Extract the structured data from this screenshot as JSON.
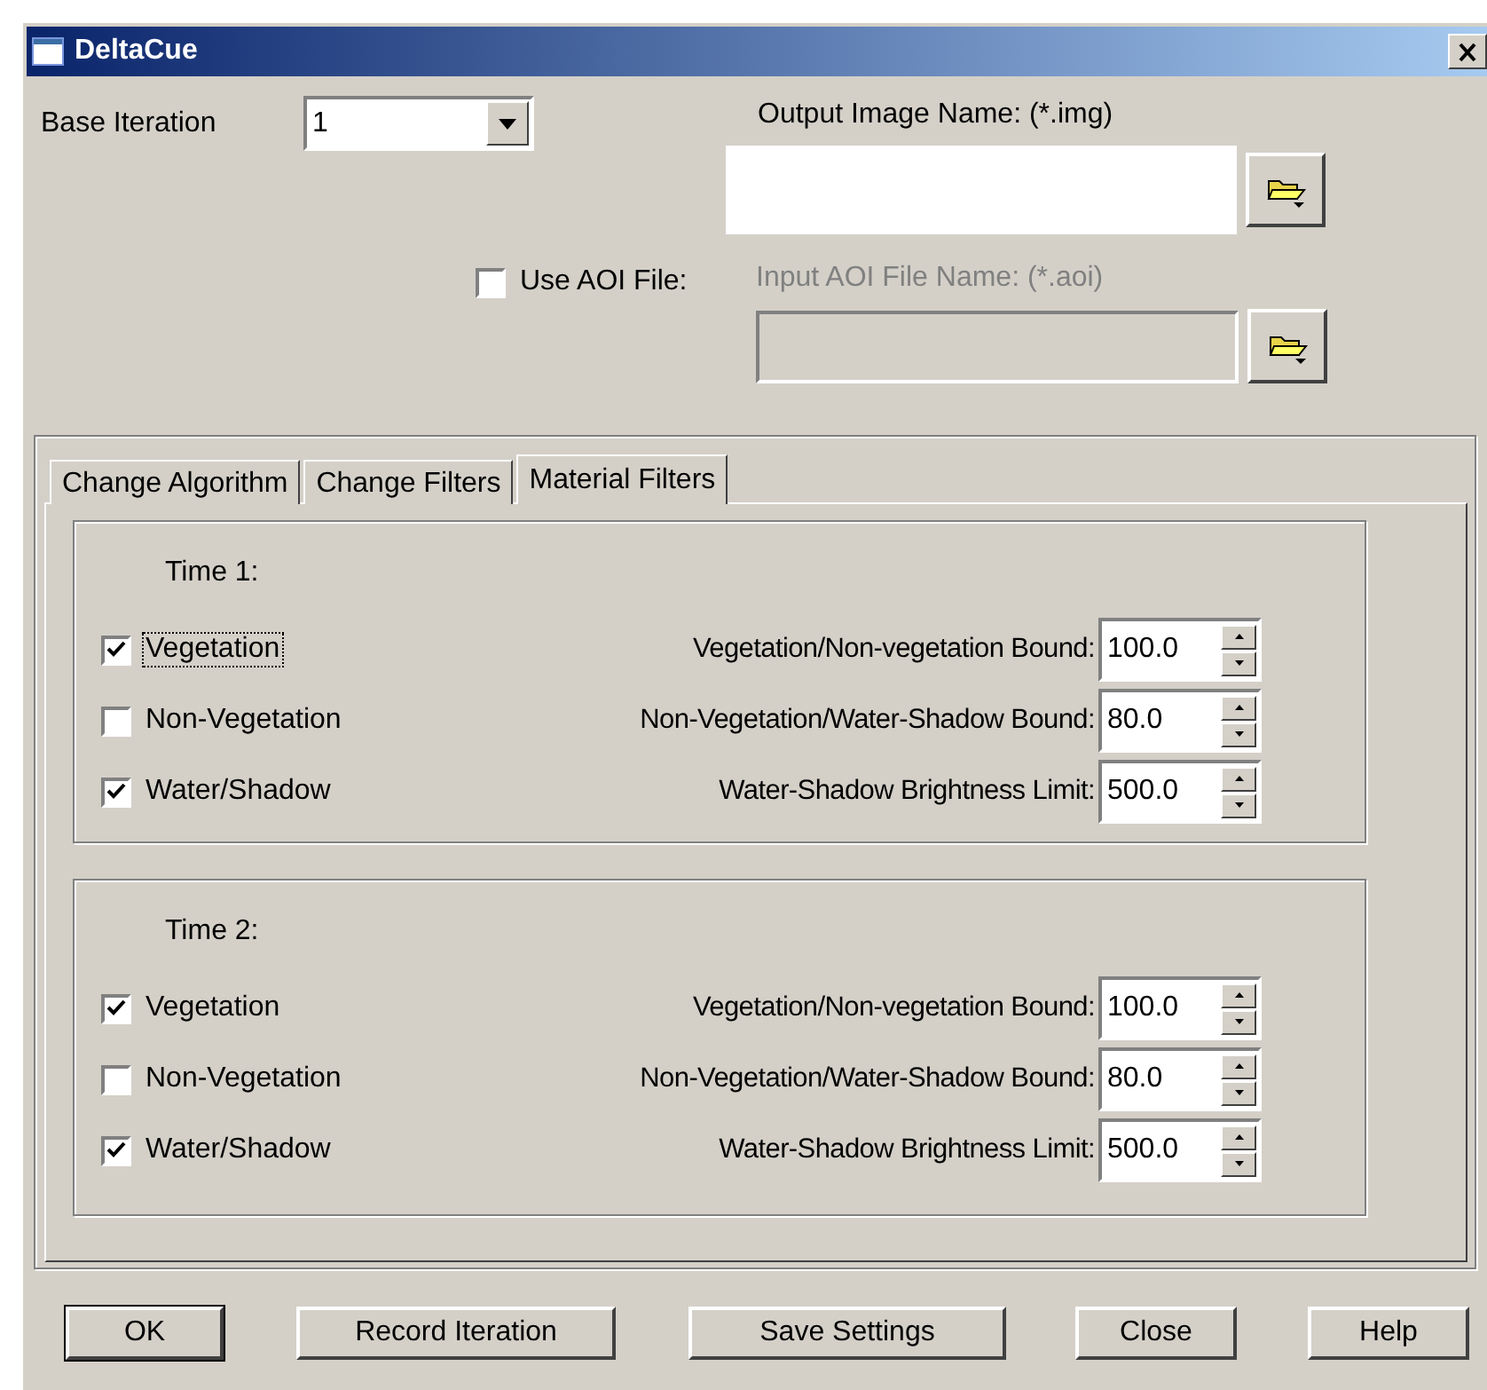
{
  "window": {
    "title": "DeltaCue"
  },
  "base_iteration": {
    "label": "Base Iteration",
    "value": "1"
  },
  "output_image": {
    "label": "Output Image Name: (*.img)"
  },
  "use_aoi": {
    "label": "Use AOI File:",
    "checked": false
  },
  "input_aoi": {
    "label": "Input AOI File Name: (*.aoi)",
    "disabled": true
  },
  "tabs": [
    {
      "label": "Change Algorithm",
      "selected": false
    },
    {
      "label": "Change Filters",
      "selected": false
    },
    {
      "label": "Material Filters",
      "selected": true
    }
  ],
  "groups": [
    {
      "title": "Time 1:",
      "filters": [
        {
          "label": "Vegetation",
          "checked": true,
          "focused": true
        },
        {
          "label": "Non-Vegetation",
          "checked": false,
          "focused": false
        },
        {
          "label": "Water/Shadow",
          "checked": true,
          "focused": false
        }
      ],
      "bounds": [
        {
          "label": "Vegetation/Non-vegetation Bound:",
          "value": "100.0"
        },
        {
          "label": "Non-Vegetation/Water-Shadow Bound:",
          "value": "80.0"
        },
        {
          "label": "Water-Shadow Brightness Limit:",
          "value": "500.0"
        }
      ]
    },
    {
      "title": "Time 2:",
      "filters": [
        {
          "label": "Vegetation",
          "checked": true,
          "focused": false
        },
        {
          "label": "Non-Vegetation",
          "checked": false,
          "focused": false
        },
        {
          "label": "Water/Shadow",
          "checked": true,
          "focused": false
        }
      ],
      "bounds": [
        {
          "label": "Vegetation/Non-vegetation Bound:",
          "value": "100.0"
        },
        {
          "label": "Non-Vegetation/Water-Shadow Bound:",
          "value": "80.0"
        },
        {
          "label": "Water-Shadow Brightness Limit:",
          "value": "500.0"
        }
      ]
    }
  ],
  "buttons": [
    {
      "label": "OK",
      "default": true
    },
    {
      "label": "Record Iteration",
      "default": false
    },
    {
      "label": "Save Settings",
      "default": false
    },
    {
      "label": "Close",
      "default": false
    },
    {
      "label": "Help",
      "default": false
    }
  ]
}
